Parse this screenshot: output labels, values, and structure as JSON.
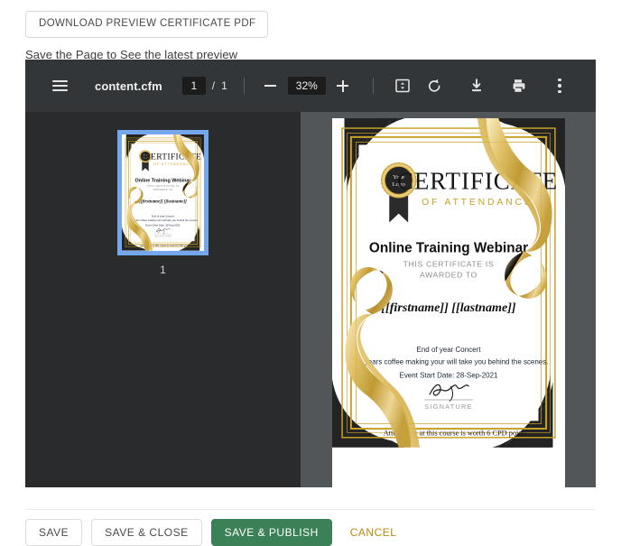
{
  "header": {
    "download_button": "DOWNLOAD PREVIEW CERTIFICATE PDF",
    "hint": "Save the Page to See the latest preview"
  },
  "viewer": {
    "filename": "content.cfm",
    "page_current": "1",
    "page_separator": "/",
    "page_total": "1",
    "zoom_level": "32%",
    "icons": {
      "menu": "hamburger-icon",
      "zoom_out": "minus-icon",
      "zoom_in": "plus-icon",
      "fit_page": "fit-page-icon",
      "rotate": "rotate-counterclockwise-icon",
      "download": "download-icon",
      "print": "print-icon",
      "more": "more-options-icon"
    },
    "thumbnail_label": "1"
  },
  "certificate": {
    "badge_line1": "Your",
    "badge_line2": "Logo",
    "title_main": "CERTIFICATE",
    "title_sub": "OF ATTENDANCE",
    "course_name": "Online Training Webinar",
    "awarded_line1": "THIS CERTIFICATE IS",
    "awarded_line2": "AWARDED TO",
    "recipient": "[[firstname]] [[lastname]]",
    "event_title": "End of year Concert",
    "description": "This years coffee making your will take you behind the scenes.",
    "event_date": "Event Start Date: 28-Sep-2021",
    "signature_text": "S. Black",
    "signature_label": "SIGNATURE",
    "footer_note": "Attendance at this course is worth 6 CPD points"
  },
  "footer": {
    "save": "SAVE",
    "save_close": "SAVE & CLOSE",
    "save_publish": "SAVE & PUBLISH",
    "cancel": "CANCEL"
  },
  "colors": {
    "publish_green": "#3a8158",
    "cancel_gold": "#b8860b",
    "toolbar_bg": "#323639",
    "thumb_pane_bg": "#2a2b2d",
    "doc_pane_bg": "#525659",
    "thumb_select": "#74a7ec",
    "cert_gold": "#c9a227"
  }
}
